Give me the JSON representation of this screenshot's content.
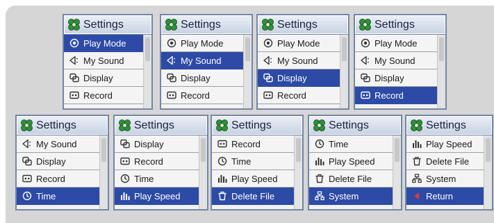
{
  "title": "Settings",
  "colors": {
    "title_text": "#1a2240",
    "selected_bg": "#2d4aa6",
    "frame_border": "#7486a6",
    "canvas_bg": "#d6d6d6"
  },
  "panels": [
    {
      "items": [
        {
          "icon": "play-mode-icon",
          "label": "Play Mode",
          "selected": true
        },
        {
          "icon": "speaker-icon",
          "label": "My Sound",
          "selected": false
        },
        {
          "icon": "display-icon",
          "label": "Display",
          "selected": false
        },
        {
          "icon": "record-icon",
          "label": "Record",
          "selected": false
        }
      ]
    },
    {
      "items": [
        {
          "icon": "play-mode-icon",
          "label": "Play Mode",
          "selected": false
        },
        {
          "icon": "speaker-icon",
          "label": "My Sound",
          "selected": true
        },
        {
          "icon": "display-icon",
          "label": "Display",
          "selected": false
        },
        {
          "icon": "record-icon",
          "label": "Record",
          "selected": false
        }
      ]
    },
    {
      "items": [
        {
          "icon": "play-mode-icon",
          "label": "Play Mode",
          "selected": false
        },
        {
          "icon": "speaker-icon",
          "label": "My Sound",
          "selected": false
        },
        {
          "icon": "display-icon",
          "label": "Display",
          "selected": true
        },
        {
          "icon": "record-icon",
          "label": "Record",
          "selected": false
        }
      ]
    },
    {
      "items": [
        {
          "icon": "play-mode-icon",
          "label": "Play Mode",
          "selected": false
        },
        {
          "icon": "speaker-icon",
          "label": "My Sound",
          "selected": false
        },
        {
          "icon": "display-icon",
          "label": "Display",
          "selected": false
        },
        {
          "icon": "record-icon",
          "label": "Record",
          "selected": true
        }
      ]
    },
    {
      "items": [
        {
          "icon": "speaker-icon",
          "label": "My Sound",
          "selected": false
        },
        {
          "icon": "display-icon",
          "label": "Display",
          "selected": false
        },
        {
          "icon": "record-icon",
          "label": "Record",
          "selected": false
        },
        {
          "icon": "clock-icon",
          "label": "Time",
          "selected": true
        }
      ]
    },
    {
      "items": [
        {
          "icon": "display-icon",
          "label": "Display",
          "selected": false
        },
        {
          "icon": "record-icon",
          "label": "Record",
          "selected": false
        },
        {
          "icon": "clock-icon",
          "label": "Time",
          "selected": false
        },
        {
          "icon": "play-speed-icon",
          "label": "Play Speed",
          "selected": true
        }
      ]
    },
    {
      "items": [
        {
          "icon": "record-icon",
          "label": "Record",
          "selected": false
        },
        {
          "icon": "clock-icon",
          "label": "Time",
          "selected": false
        },
        {
          "icon": "play-speed-icon",
          "label": "Play Speed",
          "selected": false
        },
        {
          "icon": "trash-icon",
          "label": "Delete File",
          "selected": true
        }
      ]
    },
    {
      "items": [
        {
          "icon": "clock-icon",
          "label": "Time",
          "selected": false
        },
        {
          "icon": "play-speed-icon",
          "label": "Play Speed",
          "selected": false
        },
        {
          "icon": "trash-icon",
          "label": "Delete File",
          "selected": false
        },
        {
          "icon": "system-icon",
          "label": "System",
          "selected": true
        }
      ]
    },
    {
      "items": [
        {
          "icon": "play-speed-icon",
          "label": "Play Speed",
          "selected": false
        },
        {
          "icon": "trash-icon",
          "label": "Delete File",
          "selected": false
        },
        {
          "icon": "system-icon",
          "label": "System",
          "selected": false
        },
        {
          "icon": "return-icon",
          "label": "Return",
          "selected": true
        }
      ]
    }
  ]
}
